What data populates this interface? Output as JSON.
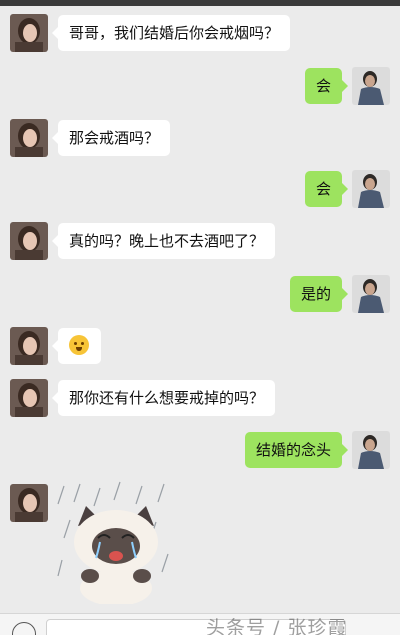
{
  "messages": [
    {
      "sender": "her",
      "text": "哥哥，我们结婚后你会戒烟吗？"
    },
    {
      "sender": "him",
      "text": "会"
    },
    {
      "sender": "her",
      "text": "那会戒酒吗？"
    },
    {
      "sender": "him",
      "text": "会"
    },
    {
      "sender": "her",
      "text": "真的吗？晚上也不去酒吧了？"
    },
    {
      "sender": "him",
      "text": "是的"
    },
    {
      "sender": "her",
      "emoji": "smile-emoji-icon"
    },
    {
      "sender": "her",
      "text": "那你还有什么想要戒掉的吗？"
    },
    {
      "sender": "him",
      "text": "结婚的念头"
    },
    {
      "sender": "her",
      "sticker": "crying-cat-sticker"
    }
  ],
  "colors": {
    "background": "#ebebeb",
    "incoming_bubble": "#ffffff",
    "outgoing_bubble": "#9de35f"
  },
  "watermark": {
    "text": "头条号 / 张珍霞"
  }
}
